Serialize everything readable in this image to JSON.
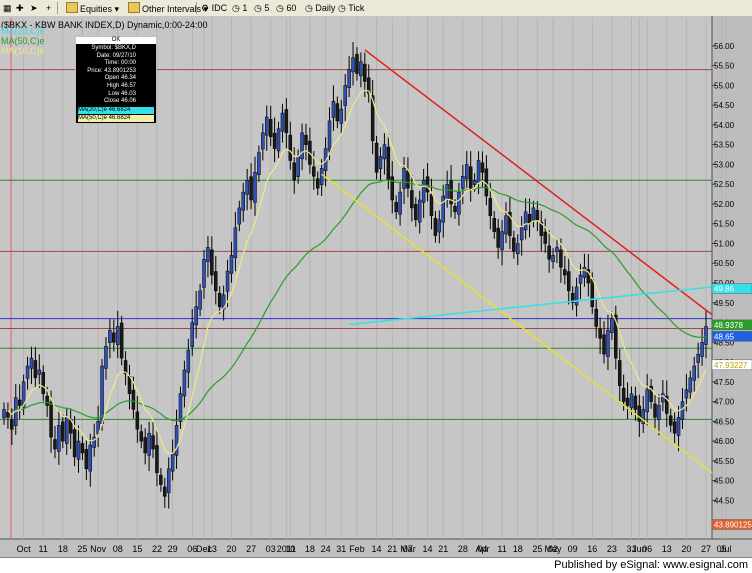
{
  "toolbar": {
    "equities": "Equities",
    "other_intervals": "Other Intervals",
    "source": "IDC",
    "intervals": [
      "1",
      "5",
      "60",
      "Daily",
      "Tick"
    ]
  },
  "chart_title": "($BKX - KBW BANK INDEX,D) Dynamic,0:00-24:00",
  "legend": [
    {
      "text": "MA(20,C)e",
      "color": "#35e0e8"
    },
    {
      "text": "MA(50,C)e",
      "color": "#2a9e2a"
    },
    {
      "text": "MA(10,C)e",
      "color": "#f0e88a"
    }
  ],
  "info_box": {
    "ok": "OK",
    "rows": [
      "Symbol: $BKX,D",
      "Date: 09/27/10",
      "Time: 00:00",
      "Price: 43.8901253",
      "Open 46.34",
      "High 46.57",
      "Low 46.03",
      "Close 46.06"
    ],
    "ma_rows": [
      {
        "text": "MA(20,C)e 46.6824",
        "bg": "#35e0e8"
      },
      {
        "text": "MA(50,C)e 46.6824",
        "bg": "#f0f0a8"
      }
    ]
  },
  "price_tags": [
    {
      "text": "48.9378",
      "value": 48.94,
      "color": "#2a9e2a",
      "text_color": "#ffffff"
    },
    {
      "text": "48.65",
      "value": 48.65,
      "color": "#2060e0",
      "text_color": "#ffffff"
    },
    {
      "text": "47.93227",
      "value": 47.93,
      "color": "#ffffff",
      "text_color": "#c0a000"
    },
    {
      "text": "43.890125",
      "value": 43.89,
      "color": "#e06030",
      "text_color": "#ffffff"
    },
    {
      "text": "49.86",
      "value": 49.86,
      "color": "#35e0e8",
      "text_color": "#ffffff"
    }
  ],
  "chart_data": {
    "type": "candlestick",
    "y_ticks": [
      44.5,
      45.0,
      45.5,
      46.0,
      46.5,
      47.0,
      47.5,
      48.0,
      48.5,
      49.0,
      49.5,
      50.0,
      50.5,
      51.0,
      51.5,
      52.0,
      52.5,
      53.0,
      53.5,
      54.0,
      54.5,
      55.0,
      55.5,
      56.0
    ],
    "y_tick_labels": [
      "44.50",
      "45.00",
      "45.50",
      "46.00",
      "46.50",
      "47.00",
      "47.50",
      "48.00",
      "48.50",
      "49.00",
      "49.50",
      "50.00",
      "50.50",
      "51.00",
      "51.50",
      "52.00",
      "52.50",
      "53.00",
      "53.50",
      "54.00",
      "54.50",
      "55.00",
      "55.50",
      "56.00"
    ],
    "ylim": [
      43.7,
      56.3
    ],
    "x_tick_labels": [
      {
        "label": "Oct",
        "idx": 5
      },
      {
        "label": "11",
        "idx": 10
      },
      {
        "label": "18",
        "idx": 15
      },
      {
        "label": "25",
        "idx": 20
      },
      {
        "label": "Nov",
        "idx": 24
      },
      {
        "label": "08",
        "idx": 29
      },
      {
        "label": "15",
        "idx": 34
      },
      {
        "label": "22",
        "idx": 39
      },
      {
        "label": "29",
        "idx": 43
      },
      {
        "label": "06",
        "idx": 48
      },
      {
        "label": "Dec",
        "idx": 51
      },
      {
        "label": "13",
        "idx": 53
      },
      {
        "label": "20",
        "idx": 58
      },
      {
        "label": "27",
        "idx": 63
      },
      {
        "label": "03",
        "idx": 68
      },
      {
        "label": "2011",
        "idx": 72
      },
      {
        "label": "10",
        "idx": 73
      },
      {
        "label": "18",
        "idx": 78
      },
      {
        "label": "24",
        "idx": 82
      },
      {
        "label": "31",
        "idx": 86
      },
      {
        "label": "Feb",
        "idx": 90
      },
      {
        "label": "14",
        "idx": 95
      },
      {
        "label": "21",
        "idx": 99
      },
      {
        "label": "Mar",
        "idx": 103
      },
      {
        "label": "07",
        "idx": 103
      },
      {
        "label": "14",
        "idx": 108
      },
      {
        "label": "21",
        "idx": 112
      },
      {
        "label": "28",
        "idx": 117
      },
      {
        "label": "04",
        "idx": 122
      },
      {
        "label": "Apr",
        "idx": 122
      },
      {
        "label": "11",
        "idx": 127
      },
      {
        "label": "18",
        "idx": 131
      },
      {
        "label": "25",
        "idx": 136
      },
      {
        "label": "02",
        "idx": 140
      },
      {
        "label": "May",
        "idx": 140
      },
      {
        "label": "09",
        "idx": 145
      },
      {
        "label": "16",
        "idx": 150
      },
      {
        "label": "23",
        "idx": 155
      },
      {
        "label": "31",
        "idx": 160
      },
      {
        "label": "Jun",
        "idx": 162
      },
      {
        "label": "06",
        "idx": 164
      },
      {
        "label": "13",
        "idx": 169
      },
      {
        "label": "20",
        "idx": 174
      },
      {
        "label": "27",
        "idx": 179
      },
      {
        "label": "05",
        "idx": 183
      },
      {
        "label": "Jul",
        "idx": 184
      }
    ],
    "h_lines": [
      {
        "value": 55.4,
        "color": "#a04848"
      },
      {
        "value": 52.6,
        "color": "#2a8a2a"
      },
      {
        "value": 50.8,
        "color": "#a04848"
      },
      {
        "value": 49.1,
        "color": "#3030d0"
      },
      {
        "value": 48.85,
        "color": "#a04848"
      },
      {
        "value": 48.35,
        "color": "#2a8a2a"
      },
      {
        "value": 46.55,
        "color": "#2a8a2a"
      }
    ],
    "trendlines": [
      {
        "color": "#e02020",
        "from": {
          "idx": 92,
          "value": 55.9
        },
        "to": {
          "idx": 185,
          "value": 49.2
        }
      },
      {
        "color": "#e8e030",
        "from": {
          "idx": 81,
          "value": 52.75
        },
        "to": {
          "idx": 185,
          "value": 45.2
        }
      },
      {
        "color": "#35e0e8",
        "from": {
          "idx": 88,
          "value": 48.95
        },
        "to": {
          "idx": 185,
          "value": 49.9
        }
      }
    ],
    "series": {
      "close": [
        46.8,
        46.6,
        46.3,
        47.1,
        46.9,
        47.5,
        47.9,
        48.1,
        47.6,
        47.8,
        47.2,
        46.9,
        46.1,
        45.8,
        46.4,
        46.0,
        46.6,
        46.2,
        45.6,
        46.0,
        45.7,
        45.3,
        45.9,
        46.1,
        46.5,
        47.9,
        48.4,
        48.8,
        48.5,
        48.9,
        48.1,
        47.7,
        47.2,
        46.8,
        46.3,
        46.0,
        45.7,
        46.2,
        45.8,
        45.2,
        44.9,
        44.6,
        45.3,
        45.7,
        46.4,
        47.2,
        47.8,
        48.3,
        49.0,
        49.4,
        49.8,
        50.6,
        50.9,
        50.2,
        49.8,
        49.4,
        49.7,
        50.3,
        50.7,
        51.4,
        51.9,
        52.3,
        52.6,
        52.1,
        52.8,
        53.3,
        53.8,
        54.2,
        53.7,
        53.4,
        53.9,
        54.3,
        53.8,
        53.1,
        52.6,
        53.2,
        53.8,
        53.5,
        53.0,
        52.7,
        52.4,
        52.9,
        53.4,
        54.1,
        54.6,
        54.1,
        54.4,
        55.0,
        55.4,
        55.7,
        55.3,
        55.6,
        55.1,
        54.8,
        53.6,
        52.8,
        53.2,
        53.5,
        52.6,
        52.1,
        51.8,
        52.3,
        52.9,
        52.4,
        51.9,
        51.6,
        52.1,
        52.6,
        52.3,
        51.7,
        51.2,
        51.6,
        52.2,
        52.5,
        52.0,
        51.8,
        52.3,
        52.7,
        53.0,
        52.4,
        52.6,
        53.1,
        52.8,
        52.2,
        51.7,
        51.3,
        50.9,
        51.3,
        51.7,
        51.2,
        50.8,
        51.0,
        51.4,
        51.8,
        51.5,
        51.9,
        51.6,
        51.2,
        51.0,
        50.6,
        50.7,
        50.9,
        50.4,
        50.2,
        49.8,
        49.5,
        49.9,
        50.2,
        50.4,
        50.0,
        49.4,
        48.9,
        48.6,
        48.2,
        48.8,
        49.1,
        48.1,
        47.4,
        47.0,
        46.9,
        47.2,
        46.8,
        46.5,
        46.8,
        47.3,
        47.0,
        46.6,
        46.9,
        47.2,
        46.7,
        46.4,
        46.2,
        46.6,
        47.0,
        47.3,
        47.6,
        47.9,
        48.2,
        48.5,
        48.9
      ],
      "open_offset": 0.3,
      "range": 0.45
    }
  }
}
